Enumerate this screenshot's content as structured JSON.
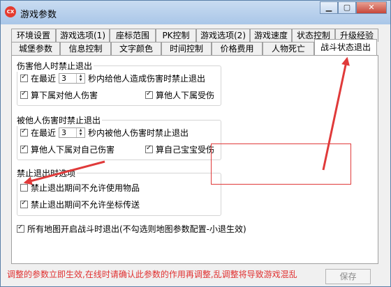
{
  "window": {
    "title": "游戏参数",
    "app_icon_text": "CX"
  },
  "tabs": {
    "row1": [
      "环境设置",
      "游戏选项(1)",
      "座标范围",
      "PK控制",
      "游戏选项(2)",
      "游戏速度",
      "状态控制",
      "升级经验"
    ],
    "row2": [
      "城堡参数",
      "信息控制",
      "文字颜色",
      "时间控制",
      "价格费用",
      "人物死亡",
      "战斗状态退出"
    ]
  },
  "group1": {
    "title": "伤害他人时禁止退出",
    "recent_label": "在最近",
    "recent_value": "3",
    "recent_suffix": "秒内给他人造成伤害时禁止退出",
    "opt_subordinate_damage": "算下属对他人伤害",
    "opt_others_subordinate_hurt": "算他人下属受伤"
  },
  "group2": {
    "title": "被他人伤害时禁止退出",
    "recent_label": "在最近",
    "recent_value": "3",
    "recent_suffix": "秒内被他人伤害时禁止退出",
    "opt_others_subordinate_damage": "算他人下属对自己伤害",
    "opt_own_pet_hurt": "算自己宝宝受伤"
  },
  "group3": {
    "title": "禁止退出时选项",
    "opt_no_items": "禁止退出期间不允许使用物品",
    "opt_no_teleport": "禁止退出期间不允许坐标传送"
  },
  "all_maps_option": "所有地图开启战斗时退出(不勾选则地图参数配置-小退生效)",
  "save_label": "保存",
  "warning": "调整的参数立即生效,在线时请确认此参数的作用再调整,乱调整将导致游戏混乱",
  "colors": {
    "warning": "#e03030",
    "annotation": "#e03a3a"
  }
}
